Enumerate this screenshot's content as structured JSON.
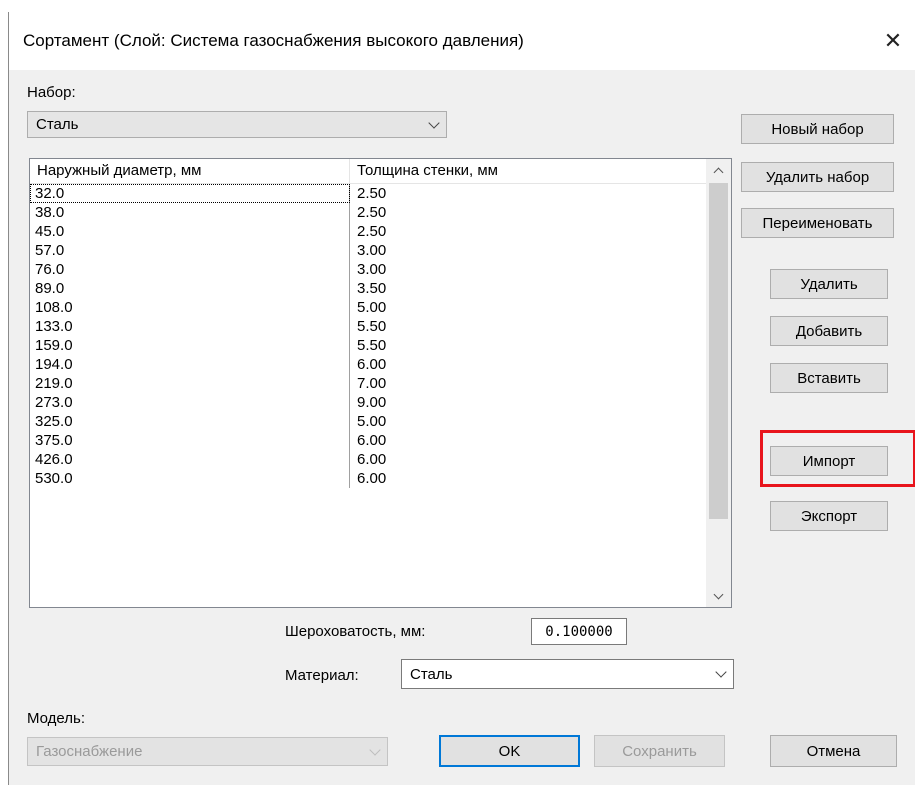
{
  "window": {
    "title": "Сортамент (Слой: Система газоснабжения высокого давления)",
    "close_glyph": "✕"
  },
  "set": {
    "label": "Набор:",
    "value": "Сталь"
  },
  "table": {
    "headers": [
      "Наружный диаметр, мм",
      "Толщина стенки, мм"
    ],
    "rows": [
      [
        "32.0",
        "2.50"
      ],
      [
        "38.0",
        "2.50"
      ],
      [
        "45.0",
        "2.50"
      ],
      [
        "57.0",
        "3.00"
      ],
      [
        "76.0",
        "3.00"
      ],
      [
        "89.0",
        "3.50"
      ],
      [
        "108.0",
        "5.00"
      ],
      [
        "133.0",
        "5.50"
      ],
      [
        "159.0",
        "5.50"
      ],
      [
        "194.0",
        "6.00"
      ],
      [
        "219.0",
        "7.00"
      ],
      [
        "273.0",
        "9.00"
      ],
      [
        "325.0",
        "5.00"
      ],
      [
        "375.0",
        "6.00"
      ],
      [
        "426.0",
        "6.00"
      ],
      [
        "530.0",
        "6.00"
      ]
    ]
  },
  "buttons": {
    "new_set": "Новый набор",
    "delete_set": "Удалить набор",
    "rename": "Переименовать",
    "delete": "Удалить",
    "add": "Добавить",
    "paste": "Вставить",
    "import": "Импорт",
    "export": "Экспорт",
    "ok": "OK",
    "save": "Сохранить",
    "cancel": "Отмена"
  },
  "roughness": {
    "label": "Шероховатость, мм:",
    "value": "0.100000"
  },
  "material": {
    "label": "Материал:",
    "value": "Сталь"
  },
  "model": {
    "label": "Модель:",
    "value": "Газоснабжение"
  },
  "colors": {
    "highlight": "#e8141c",
    "default_button_border": "#0078d7"
  }
}
